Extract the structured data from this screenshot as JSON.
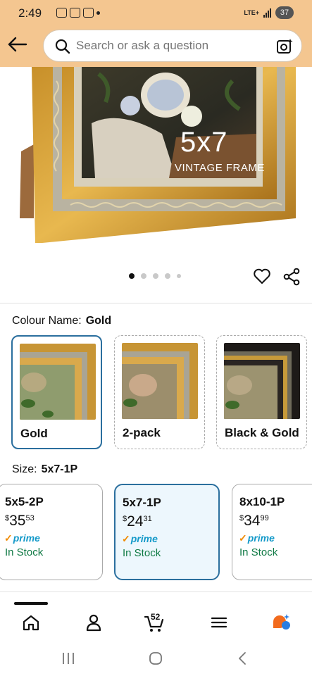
{
  "status_bar": {
    "time": "2:49",
    "network": "LTE+",
    "battery": "37"
  },
  "search": {
    "placeholder": "Search or ask a question",
    "value": ""
  },
  "product_image": {
    "overlay_size": "5x7",
    "overlay_caption": "VINTAGE FRAME"
  },
  "carousel": {
    "total": 5,
    "active": 0
  },
  "colour": {
    "label": "Colour Name:",
    "selected": "Gold",
    "options": [
      {
        "name": "Gold",
        "selected": true
      },
      {
        "name": "2-pack",
        "selected": false
      },
      {
        "name": "Black & Gold",
        "selected": false
      }
    ]
  },
  "size": {
    "label": "Size:",
    "selected": "5x7-1P",
    "options": [
      {
        "name": "5x5-2P",
        "currency": "$",
        "whole": "35",
        "fraction": "53",
        "prime": "prime",
        "stock": "In Stock",
        "selected": false
      },
      {
        "name": "5x7-1P",
        "currency": "$",
        "whole": "24",
        "fraction": "31",
        "prime": "prime",
        "stock": "In Stock",
        "selected": true
      },
      {
        "name": "8x10-1P",
        "currency": "$",
        "whole": "34",
        "fraction": "99",
        "prime": "prime",
        "stock": "In Stock",
        "selected": false
      }
    ]
  },
  "bottom_nav": {
    "cart_count": "52"
  },
  "colors": {
    "header": "#f4c690",
    "selected_border": "#2b6f9e",
    "prime": "#1399c9",
    "in_stock": "#107a45"
  }
}
